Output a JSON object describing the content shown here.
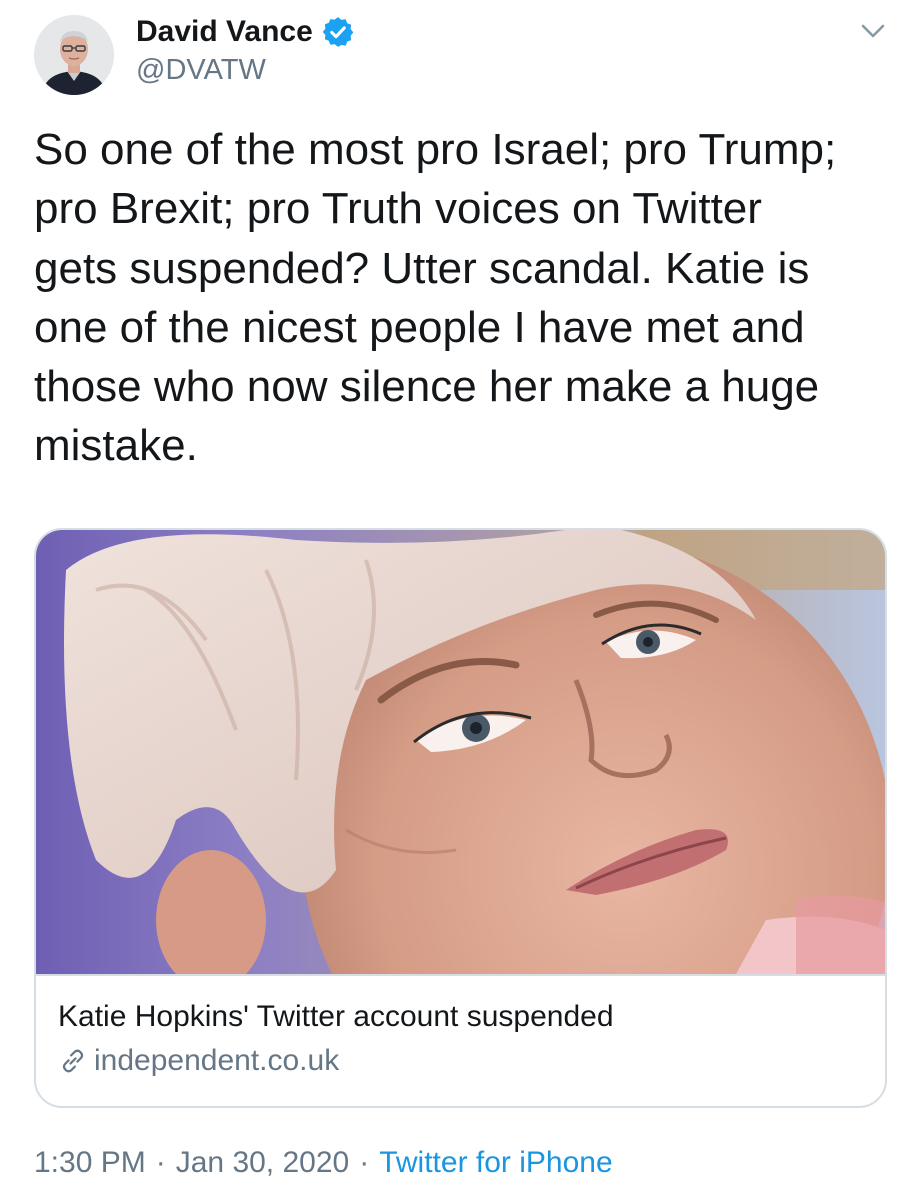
{
  "author": {
    "display_name": "David Vance",
    "handle": "@DVATW",
    "verified": true,
    "avatar_icon": "avatar-photo",
    "verified_icon": "verified-badge-icon"
  },
  "tweet": {
    "text": "So one of the most pro Israel; pro Trump;\npro Brexit; pro Truth voices on Twitter\ngets suspended? Utter scandal. Katie is\none of the nicest people I have met and\nthose who now silence her make a huge\nmistake."
  },
  "card": {
    "title": "Katie Hopkins' Twitter account suspended",
    "domain": "independent.co.uk",
    "domain_icon": "link-icon",
    "image_icon": "portrait-photo"
  },
  "meta": {
    "time": "1:30 PM",
    "separator": "·",
    "date": "Jan 30, 2020",
    "source": "Twitter for iPhone"
  },
  "menu": {
    "icon": "chevron-down-icon"
  },
  "colors": {
    "text_primary": "#14171a",
    "text_secondary": "#657786",
    "link": "#1b95e0",
    "verified": "#1da1f2",
    "border": "#d6dde3"
  }
}
